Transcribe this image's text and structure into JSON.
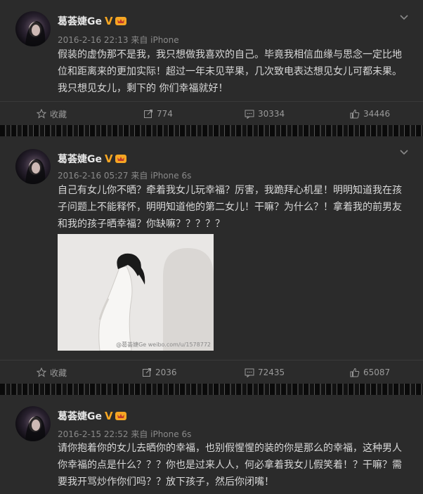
{
  "posts": [
    {
      "author": "葛荟婕Ge",
      "verified": "V",
      "meta": "2016-2-16 22:13 来自 iPhone",
      "lines": [
        "假装的虚伪那不是我，我只想做我喜欢的自己。毕竟我相信血缘与思念一定比地",
        "位和距离来的更加实际！超过一年未见苹果，几次致电表达想见女儿可都未果。",
        "我只想见女儿，剩下的 你们幸福就好！"
      ],
      "actions": {
        "fav": "收藏",
        "repost": "774",
        "comment": "30334",
        "like": "34446"
      }
    },
    {
      "author": "葛荟婕Ge",
      "verified": "V",
      "meta": "2016-2-16 05:27 来自 iPhone 6s",
      "lines": [
        "自己有女儿你不晒？牵着我女儿玩幸福？厉害，我跪拜心机星！明明知道我在孩",
        "子问题上不能释怀，明明知道他的第二女儿！干嘛？为什么？！拿着我的前男友",
        "和我的孩子晒幸福？你缺嘛？？？？？"
      ],
      "watermark": "@葛荟婕Ge  weibo.com/u/1578772",
      "actions": {
        "fav": "收藏",
        "repost": "2036",
        "comment": "72435",
        "like": "65087"
      }
    },
    {
      "author": "葛荟婕Ge",
      "verified": "V",
      "meta": "2016-2-15 22:52 来自 iPhone 6s",
      "lines": [
        "请你抱着你的女儿去晒你的幸福，也别假惺惺的装的你是那么的幸福，这种男人",
        "你幸福的点是什么？？？你也是过来人人，何必拿着我女儿假笑着！？干嘛？需",
        "要我开骂炒作你们吗？？放下孩子，然后你闭嘴！"
      ]
    }
  ],
  "icons": {
    "fav": "star-icon",
    "repost": "repost-icon",
    "comment": "comment-icon",
    "like": "like-icon",
    "menu": "chevron-down-icon"
  },
  "colors": {
    "background": "#2b2b2b",
    "verified": "#f5a623",
    "text": "#d8d8d8",
    "meta": "#8a8a8a"
  }
}
